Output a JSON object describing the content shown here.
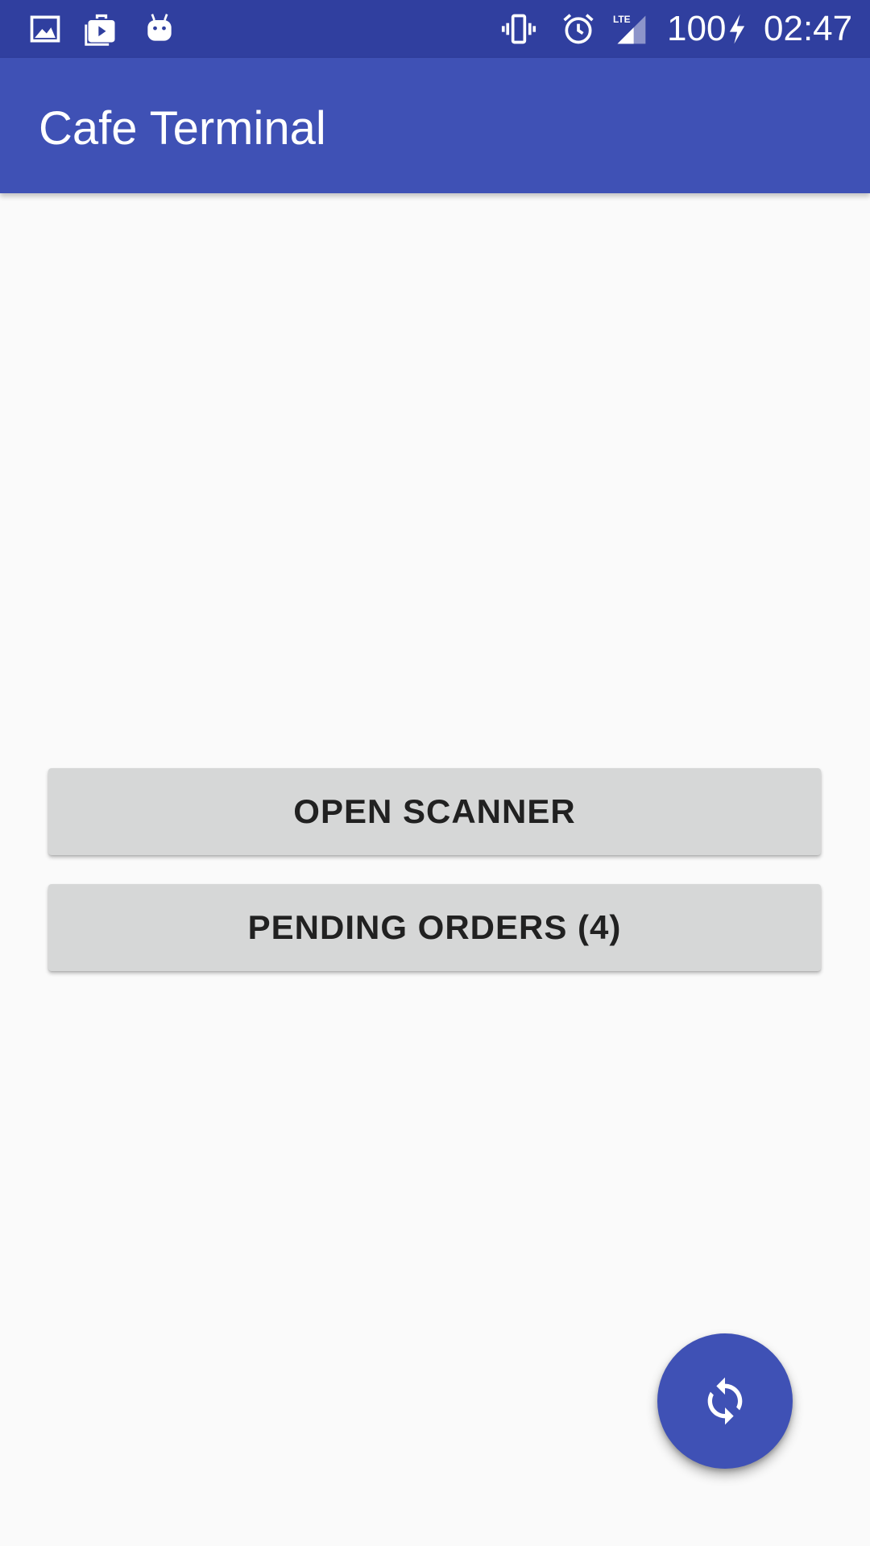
{
  "status_bar": {
    "left_icons": [
      "image-icon",
      "play-store-icon",
      "android-icon"
    ],
    "right_icons": [
      "vibrate-icon",
      "alarm-icon",
      "lte-signal-icon",
      "battery-charging-icon"
    ],
    "network_label": "LTE",
    "battery_level": "100",
    "time": "02:47",
    "background_color": "#303f9f"
  },
  "app_bar": {
    "title": "Cafe Terminal",
    "background_color": "#3f51b5"
  },
  "main": {
    "open_scanner_label": "OPEN SCANNER",
    "pending_orders_label": "PENDING ORDERS (4)",
    "button_color": "#d6d7d7"
  },
  "fab": {
    "icon": "sync-icon",
    "color": "#3f51b5"
  }
}
